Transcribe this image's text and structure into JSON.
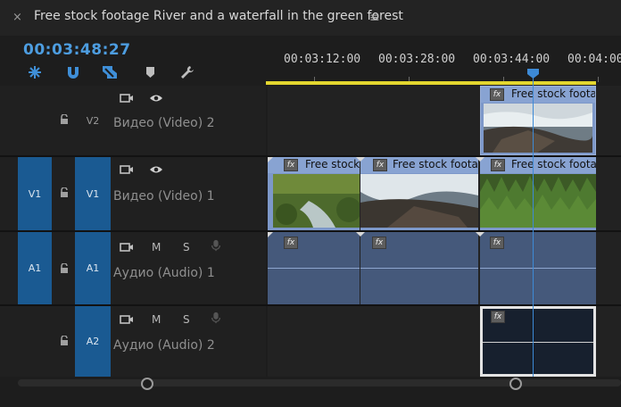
{
  "panel": {
    "close_icon": "×",
    "title": "Free stock footage River and a waterfall in the green forest",
    "menu_icon": "≡",
    "timecode": "00:03:48:27"
  },
  "ruler": {
    "labels": [
      "00:03:12:00",
      "00:03:28:00",
      "00:03:44:00",
      "00:04:00"
    ]
  },
  "tools": [
    "snap-icon",
    "magnet-icon",
    "linked-selection-icon",
    "add-marker-icon",
    "wrench-icon"
  ],
  "tracks": {
    "v2": {
      "target": "V2",
      "name": "Видео (Video) 2"
    },
    "v1": {
      "source": "V1",
      "target": "V1",
      "name": "Видео (Video) 1"
    },
    "a1": {
      "source": "A1",
      "target": "A1",
      "name": "Аудио (Audio) 1",
      "mute": "M",
      "solo": "S"
    },
    "a2": {
      "target": "A2",
      "name": "Аудио (Audio) 2",
      "mute": "M",
      "solo": "S"
    }
  },
  "clips": {
    "fx": "fx",
    "v2_clip": "Free stock footag",
    "v1_clip1": "Free stock f",
    "v1_clip2": "Free stock footage",
    "v1_clip3": "Free stock footage"
  },
  "colors": {
    "timecode": "#4d9de0",
    "track_target": "#1a5a92",
    "video_clip": "#7d98c9",
    "audio_clip": "#45597b",
    "work_area": "#e3d62f",
    "playhead": "#3d8ad6"
  }
}
